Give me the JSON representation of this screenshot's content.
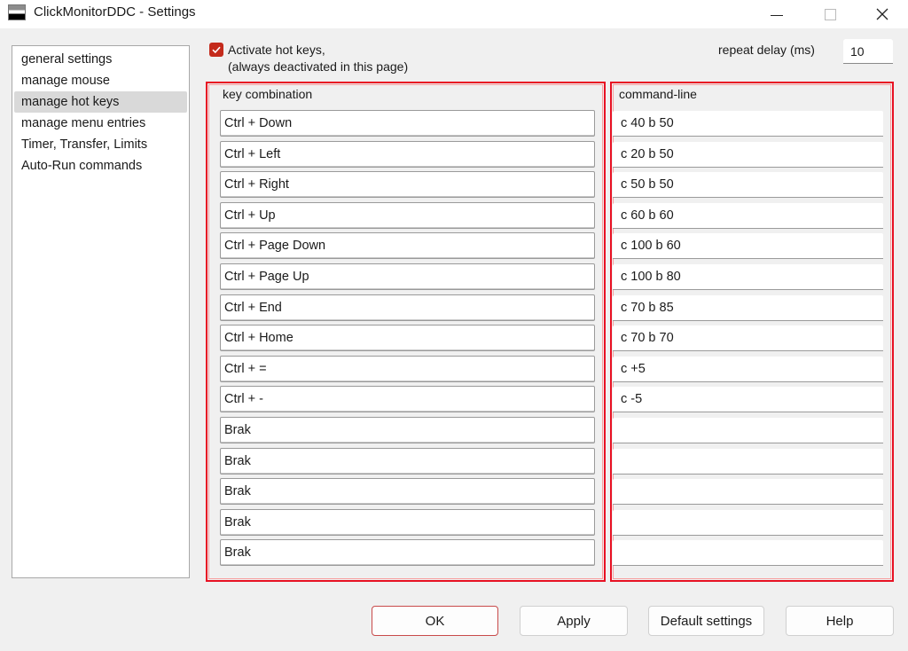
{
  "window": {
    "title": "ClickMonitorDDC - Settings",
    "app_icon": "monitor-icon",
    "controls": {
      "minimize": "minimize-icon",
      "maximize": "maximize-icon",
      "close": "close-icon"
    }
  },
  "sidebar": {
    "selected_index": 2,
    "items": [
      {
        "label": "general settings"
      },
      {
        "label": "manage mouse"
      },
      {
        "label": "manage hot keys"
      },
      {
        "label": "manage menu entries"
      },
      {
        "label": "Timer, Transfer, Limits"
      },
      {
        "label": "Auto-Run commands"
      }
    ]
  },
  "hotkeys": {
    "activate_checked": true,
    "activate_label_line1": "Activate hot keys,",
    "activate_label_line2": "(always deactivated in this page)",
    "repeat_delay_label": "repeat delay (ms)",
    "repeat_delay_value": "10",
    "accent_color": "#e81123",
    "key_column_label": "key combination",
    "command_column_label": "command-line",
    "rows": [
      {
        "key": "Ctrl + Down",
        "command": "c 40 b 50"
      },
      {
        "key": "Ctrl + Left",
        "command": "c 20 b 50"
      },
      {
        "key": "Ctrl + Right",
        "command": "c 50 b 50"
      },
      {
        "key": "Ctrl + Up",
        "command": "c 60 b 60"
      },
      {
        "key": "Ctrl + Page Down",
        "command": "c 100 b 60"
      },
      {
        "key": "Ctrl + Page Up",
        "command": "c 100 b 80"
      },
      {
        "key": "Ctrl + End",
        "command": "c 70 b 85"
      },
      {
        "key": "Ctrl + Home",
        "command": "c 70 b 70"
      },
      {
        "key": "Ctrl + =",
        "command": "c +5"
      },
      {
        "key": "Ctrl + -",
        "command": "c -5"
      },
      {
        "key": "Brak",
        "command": ""
      },
      {
        "key": "Brak",
        "command": ""
      },
      {
        "key": "Brak",
        "command": ""
      },
      {
        "key": "Brak",
        "command": ""
      },
      {
        "key": "Brak",
        "command": ""
      }
    ]
  },
  "buttons": {
    "ok": "OK",
    "apply": "Apply",
    "default_settings": "Default settings",
    "help": "Help"
  }
}
